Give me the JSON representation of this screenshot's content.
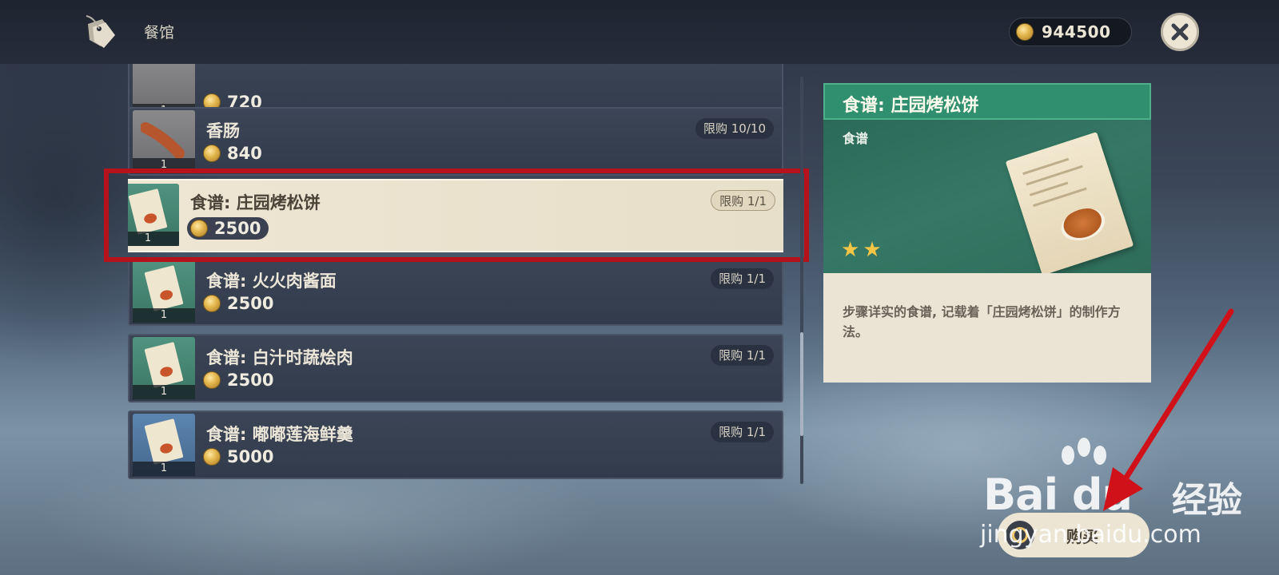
{
  "header": {
    "shop_title": "餐馆",
    "currency_amount": "944500"
  },
  "items": [
    {
      "name": "",
      "price": "720",
      "qty": "1",
      "limit": ""
    },
    {
      "name": "香肠",
      "price": "840",
      "qty": "1",
      "limit": "限购 10/10"
    },
    {
      "name": "食谱: 庄园烤松饼",
      "price": "2500",
      "qty": "1",
      "limit": "限购 1/1",
      "selected": true
    },
    {
      "name": "食谱: 火火肉酱面",
      "price": "2500",
      "qty": "1",
      "limit": "限购 1/1"
    },
    {
      "name": "食谱: 白汁时蔬烩肉",
      "price": "2500",
      "qty": "1",
      "limit": "限购 1/1"
    },
    {
      "name": "食谱: 嘟嘟莲海鲜羹",
      "price": "5000",
      "qty": "1",
      "limit": "限购 1/1"
    }
  ],
  "detail": {
    "title": "食谱: 庄园烤松饼",
    "type": "食谱",
    "stars": 2,
    "description": "步骤详实的食谱, 记载着「庄园烤松饼」的制作方法。"
  },
  "buy_button": {
    "label": "购买"
  },
  "watermark": {
    "brand": "Bai du",
    "cn": "经验",
    "url": "jingyan.baidu.com"
  },
  "colors": {
    "highlight_frame": "#b5121b",
    "accent_green": "#2f8f6e",
    "star": "#f5c646"
  }
}
